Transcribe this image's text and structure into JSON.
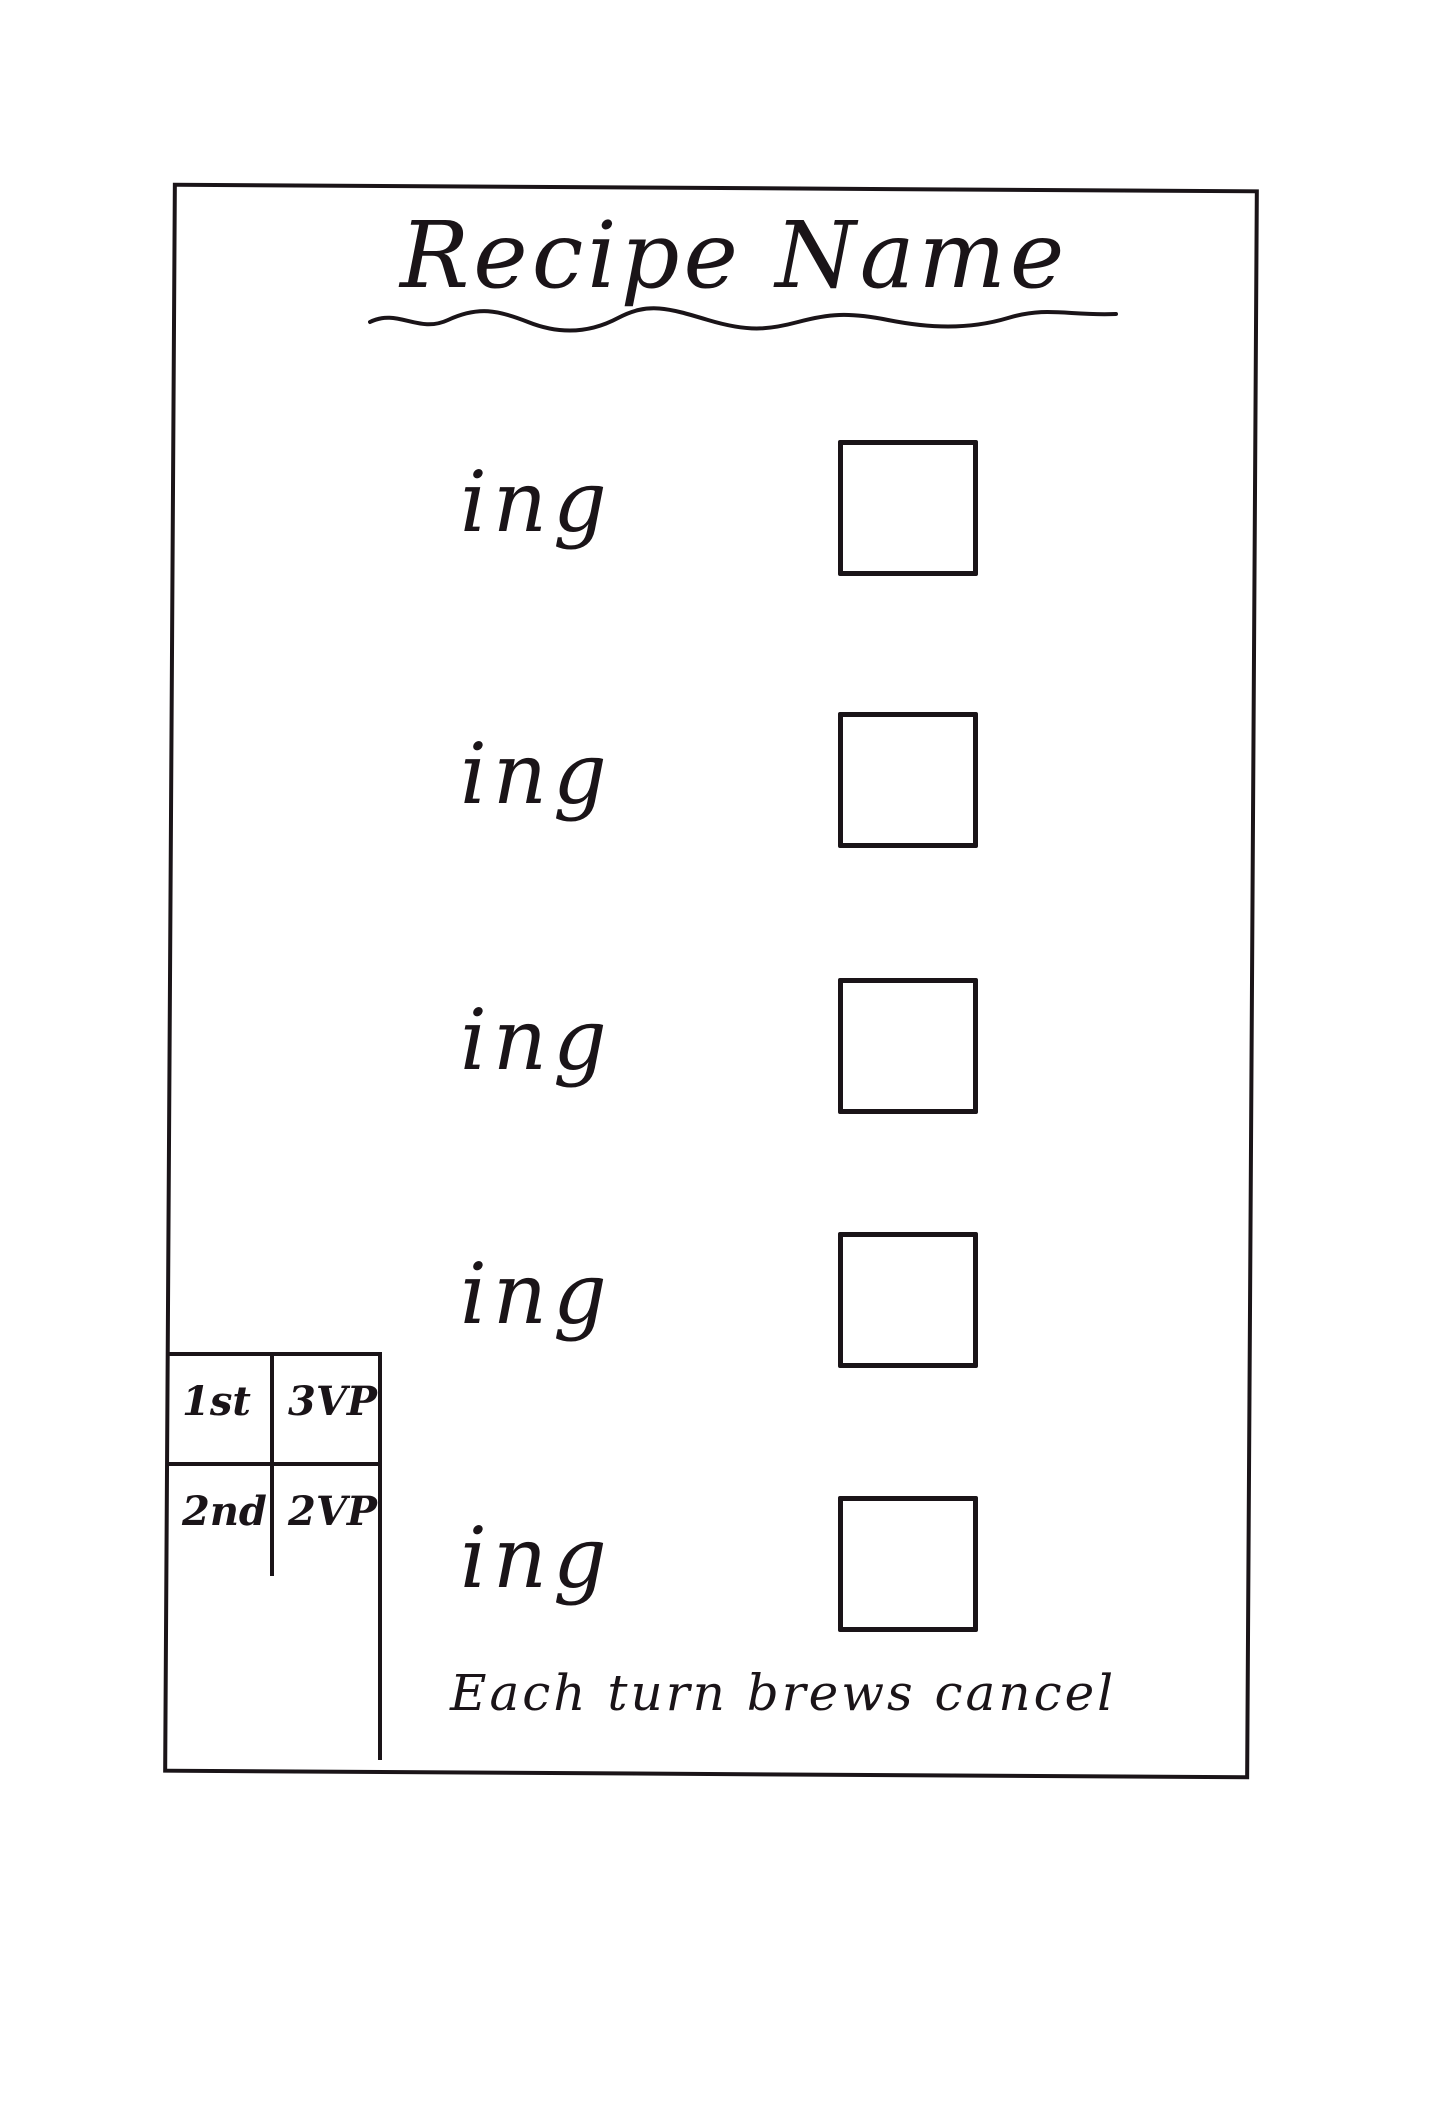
{
  "card": {
    "title": "Recipe Name",
    "ingredients": [
      {
        "label": "ing"
      },
      {
        "label": "ing"
      },
      {
        "label": "ing"
      },
      {
        "label": "ing"
      },
      {
        "label": "ing"
      }
    ],
    "footer_text": "Each turn brews cancel",
    "scoring": [
      {
        "place": "1st",
        "points": "3VP"
      },
      {
        "place": "2nd",
        "points": "2VP"
      }
    ]
  }
}
